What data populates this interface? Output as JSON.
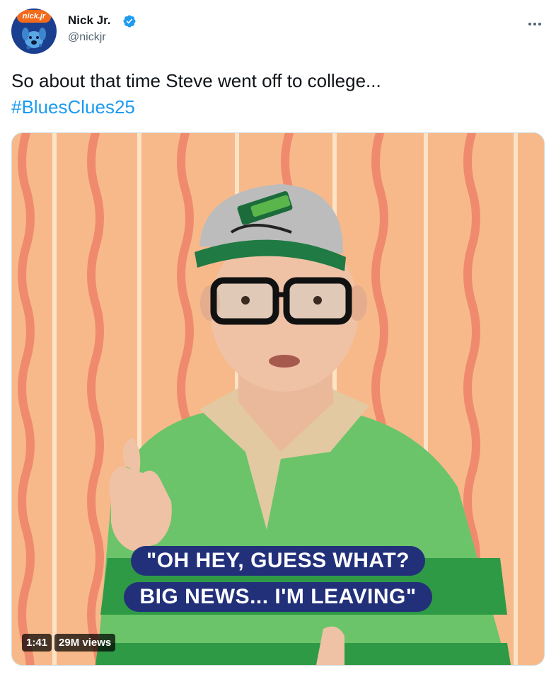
{
  "author": {
    "display_name": "Nick Jr.",
    "handle": "@nickjr",
    "avatar_logo_text": "nick.jr"
  },
  "icons": {
    "verified": "verified-badge-icon",
    "more": "more-options-icon"
  },
  "tweet": {
    "text": "So about that time Steve went off to college...",
    "hashtag": "#BluesClues25"
  },
  "video": {
    "caption_line1": "\"OH HEY, GUESS WHAT?",
    "caption_line2": "BIG NEWS... I'M LEAVING\"",
    "duration": "1:41",
    "views": "29M views"
  },
  "colors": {
    "link": "#1d9bf0",
    "verified": "#1d9bf0",
    "caption_bg": "#22307a"
  }
}
